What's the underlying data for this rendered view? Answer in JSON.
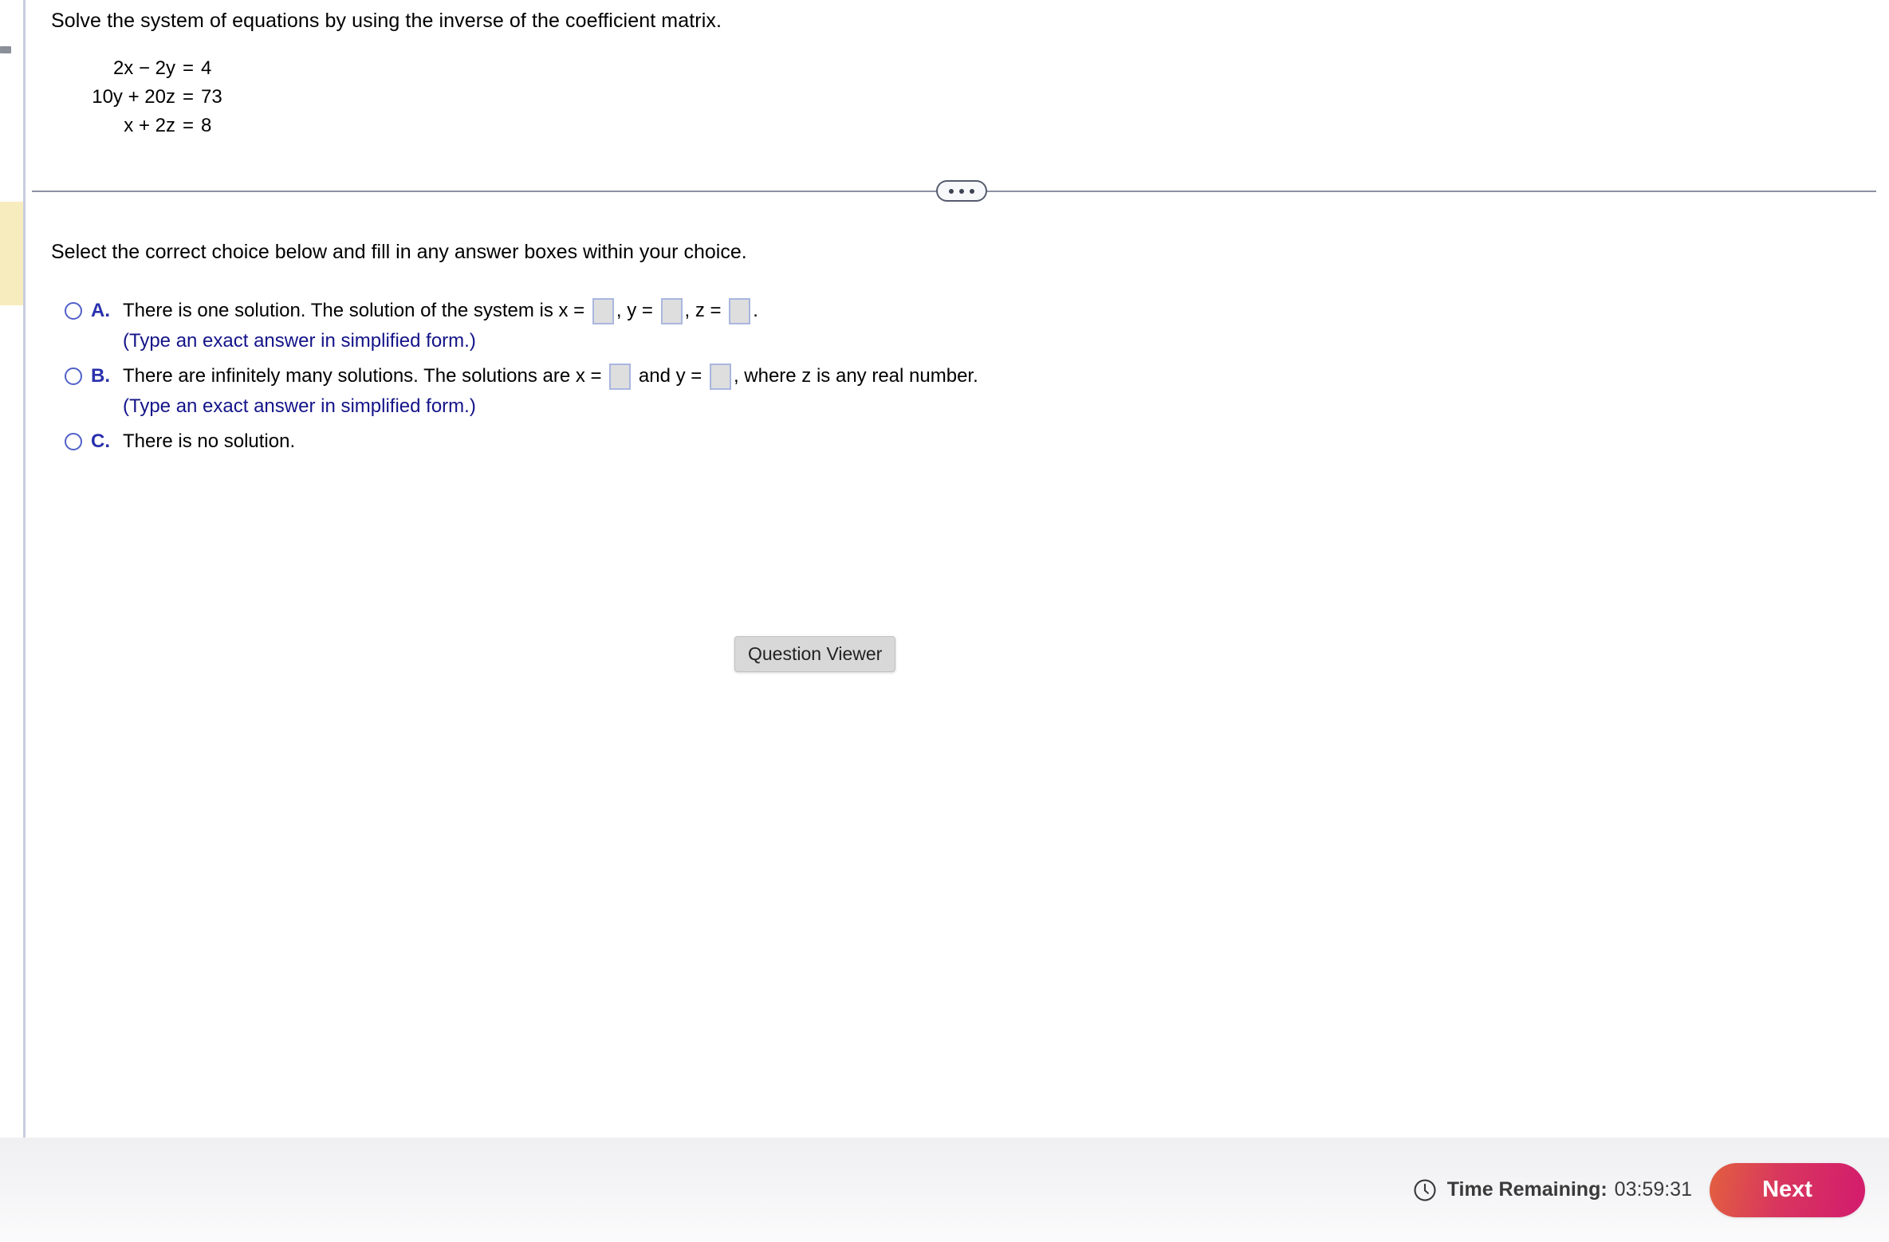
{
  "question": {
    "prompt": "Solve the system of equations by using the inverse of the coefficient matrix.",
    "equations": [
      {
        "lhs": "2x − 2y",
        "eq": "=",
        "rhs": "4"
      },
      {
        "lhs": "10y + 20z",
        "eq": "=",
        "rhs": "73"
      },
      {
        "lhs": "x + 2z",
        "eq": "=",
        "rhs": "8"
      }
    ]
  },
  "instruction": "Select the correct choice below and fill in any answer boxes within your choice.",
  "choices": [
    {
      "letter": "A.",
      "selected": false,
      "segments": [
        "There is one solution. The solution of the system is x = ",
        ", y = ",
        ", z = ",
        "."
      ],
      "boxes": [
        "",
        "",
        ""
      ],
      "box_values": {
        "x": "",
        "y": "",
        "z": ""
      },
      "hint": "(Type an exact answer in simplified form.)"
    },
    {
      "letter": "B.",
      "selected": false,
      "segments": [
        "There are infinitely many solutions. The solutions are x = ",
        " and y = ",
        ", where z is any real number."
      ],
      "boxes": [
        "",
        ""
      ],
      "box_values": {
        "x": "",
        "y": ""
      },
      "hint": "(Type an exact answer in simplified form.)"
    },
    {
      "letter": "C.",
      "selected": false,
      "segments": [
        "There is no solution."
      ],
      "boxes": [],
      "hint": ""
    }
  ],
  "tooltip": {
    "label": "Question Viewer"
  },
  "divider": {
    "dots": "•••"
  },
  "footer": {
    "timer_label": "Time Remaining:",
    "timer_value": "03:59:31",
    "next_label": "Next",
    "clock_icon": "clock-icon"
  },
  "colors": {
    "choice_letter": "#2a31ad",
    "hint_text": "#141489",
    "radio_border": "#5060c8",
    "answer_box_border": "#a9b6e0",
    "answer_box_fill": "#dedede",
    "highlight_marker": "#f7ecbe",
    "rail_divider": "#c8cddd",
    "next_gradient_start": "#e2603f",
    "next_gradient_end": "#d31b6e",
    "timer_text": "#3a3a3a"
  }
}
